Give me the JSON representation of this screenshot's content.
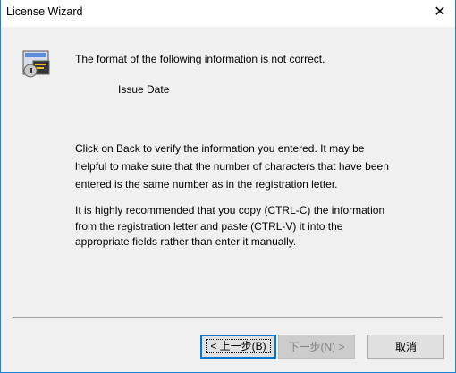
{
  "window": {
    "title": "License Wizard",
    "close_glyph": "✕"
  },
  "message": {
    "heading": "The format of the following information is not correct.",
    "field": "Issue Date",
    "para1": [
      "Click on Back to verify the information you entered.  It may be",
      "helpful to make sure that the number of characters that have been",
      "entered is the same number as in the registration letter."
    ],
    "para2": [
      "It is highly recommended that you copy (CTRL-C) the information",
      "from the registration letter and paste (CTRL-V) it into the",
      "appropriate fields rather than enter it manually."
    ]
  },
  "buttons": {
    "back": "< 上一步(B)",
    "next": "下一步(N) >",
    "cancel": "取消"
  }
}
